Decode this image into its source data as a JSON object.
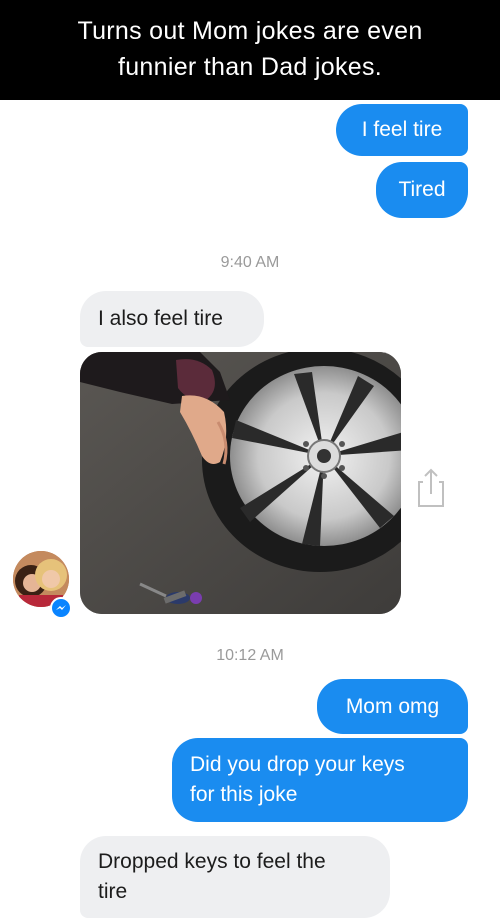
{
  "caption": {
    "line1": "Turns out Mom jokes are even",
    "line2": "funnier than Dad jokes."
  },
  "messages": [
    {
      "id": "m1",
      "sender": "me",
      "text": "I feel tire"
    },
    {
      "id": "m2",
      "sender": "me",
      "text": "Tired"
    },
    {
      "id": "m3",
      "sender": "mom",
      "text": "I also feel tire"
    },
    {
      "id": "m5",
      "sender": "me",
      "text": "Mom omg"
    },
    {
      "id": "m6",
      "sender": "me",
      "line1": "Did you drop your keys",
      "line2": "for this joke"
    },
    {
      "id": "m7",
      "sender": "mom",
      "line1": "Dropped keys to feel the",
      "line2": "tire"
    }
  ],
  "timestamps": [
    "9:40 AM",
    "10:12 AM"
  ],
  "colors": {
    "caption_bg": "#000000",
    "outgoing_bubble": "#1a8cf0",
    "incoming_bubble": "#eeeff1",
    "timestamp_text": "#9a9a9a",
    "messenger_badge": "#0a84ff"
  },
  "icons": {
    "share": "share-icon",
    "messenger": "messenger-icon"
  }
}
